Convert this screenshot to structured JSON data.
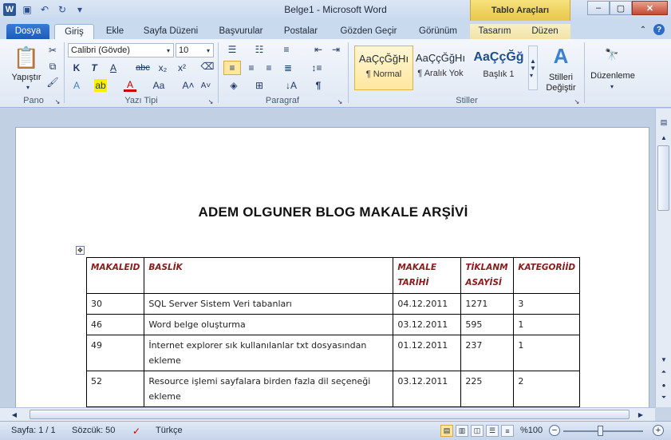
{
  "window": {
    "title": "Belge1  -  Microsoft Word",
    "context_tab_group": "Tablo Araçları"
  },
  "tabs": [
    "Dosya",
    "Giriş",
    "Ekle",
    "Sayfa Düzeni",
    "Başvurular",
    "Postalar",
    "Gözden Geçir",
    "Görünüm",
    "Tasarım",
    "Düzen"
  ],
  "ribbon": {
    "paste_label": "Yapıştır",
    "font_name": "Calibri (Gövde)",
    "font_size": "10",
    "groups": {
      "pano": "Pano",
      "yazi_tipi": "Yazı Tipi",
      "paragraf": "Paragraf",
      "stiller": "Stiller",
      "duzenleme": "Düzenleme"
    },
    "styles": [
      {
        "sample": "AaÇçĞğHı",
        "name": "¶ Normal"
      },
      {
        "sample": "AaÇçĞğHı",
        "name": "¶ Aralık Yok"
      },
      {
        "sample": "AaÇçĞğ",
        "name": "Başlık 1"
      }
    ],
    "change_styles_line1": "Stilleri",
    "change_styles_line2": "Değiştir",
    "editing_label": "Düzenleme"
  },
  "document": {
    "title": "ADEM OLGUNER BLOG MAKALE ARŞİVİ",
    "table": {
      "headers": [
        "MAKALEID",
        "BASLİK",
        "MAKALE TARİHİ",
        "TİKLANM ASAYİSİ",
        "KATEGORİİD"
      ],
      "rows": [
        [
          "30",
          "SQL Server Sistem Veri tabanları",
          "04.12.2011",
          "1271",
          "3"
        ],
        [
          "46",
          "Word belge oluşturma",
          "03.12.2011",
          "595",
          "1"
        ],
        [
          "49",
          "İnternet explorer sık kullanılanlar txt dosyasından ekleme",
          "01.12.2011",
          "237",
          "1"
        ],
        [
          "52",
          "Resource işlemi sayfalara birden fazla dil seçeneği ekleme",
          "03.12.2011",
          "225",
          "2"
        ]
      ]
    }
  },
  "status": {
    "page": "Sayfa: 1 / 1",
    "words": "Sözcük: 50",
    "language": "Türkçe",
    "zoom": "%100"
  }
}
